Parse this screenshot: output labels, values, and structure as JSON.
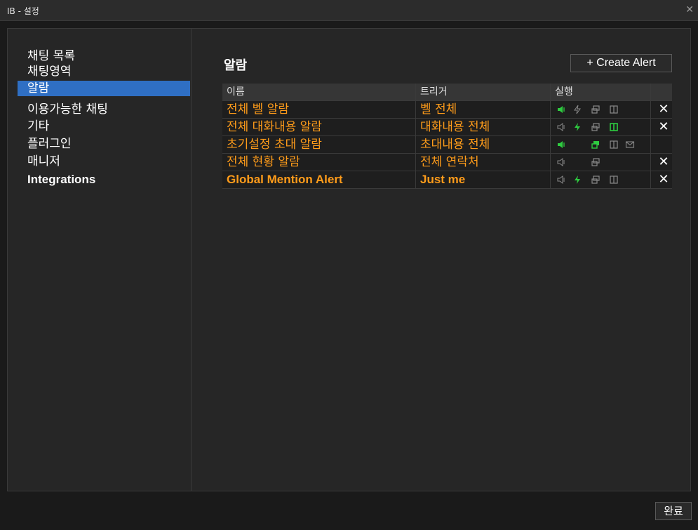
{
  "window": {
    "title": "IB - 설정"
  },
  "sidebar": {
    "items": [
      {
        "label": "채팅 목록"
      },
      {
        "label": "채팅영역"
      },
      {
        "label": "알람"
      },
      {
        "label": "이용가능한 채팅"
      },
      {
        "label": "기타"
      },
      {
        "label": "플러그인"
      },
      {
        "label": "매니저"
      },
      {
        "label": "Integrations"
      }
    ],
    "selected": "알람"
  },
  "main": {
    "title": "알람",
    "create_button": "+ Create Alert",
    "table": {
      "headers": [
        "이름",
        "트리거",
        "실행"
      ],
      "rows": [
        {
          "name": "전체 벨 알람",
          "trigger": "벨 전체",
          "actions": {
            "sound": "on",
            "bolt": "off",
            "window": "off",
            "panel": "off",
            "mail": "none"
          },
          "deletable": true
        },
        {
          "name": "전체 대화내용 알람",
          "trigger": "대화내용 전체",
          "actions": {
            "sound": "off",
            "bolt": "on",
            "window": "off",
            "panel": "on",
            "mail": "none"
          },
          "deletable": true
        },
        {
          "name": "초기설정 초대 알람",
          "trigger": "초대내용 전체",
          "actions": {
            "sound": "on",
            "bolt": "none",
            "window": "on",
            "panel": "off",
            "mail": "off"
          },
          "deletable": false
        },
        {
          "name": "전체 현황 알람",
          "trigger": "전체 연락처",
          "actions": {
            "sound": "off",
            "bolt": "none",
            "window": "off",
            "panel": "none",
            "mail": "none"
          },
          "deletable": true
        },
        {
          "name": "Global Mention Alert",
          "trigger": "Just me",
          "actions": {
            "sound": "off",
            "bolt": "on",
            "window": "off",
            "panel": "off",
            "mail": "none"
          },
          "deletable": true
        }
      ]
    }
  },
  "footer": {
    "done_button": "완료"
  },
  "colors": {
    "accent_orange": "#ff9c1a",
    "active_green": "#2ecc40",
    "inactive_gray": "#8a8a8a",
    "selection_blue": "#2f6fc4"
  },
  "icons": {
    "sound": "speaker-icon",
    "bolt": "lightning-icon",
    "window": "popup-window-icon",
    "panel": "panel-icon",
    "mail": "mail-icon",
    "delete": "close-icon"
  }
}
